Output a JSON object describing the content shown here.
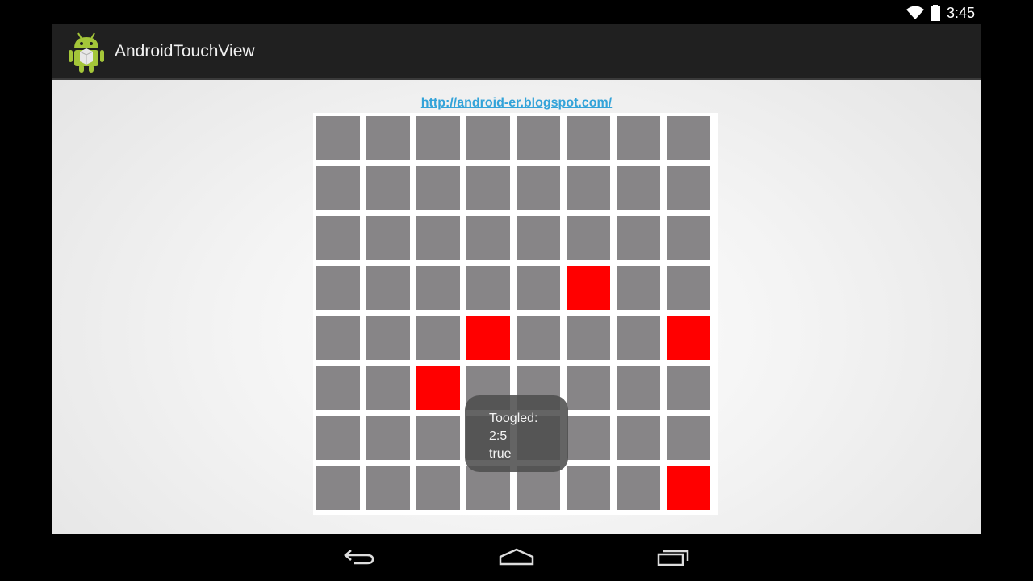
{
  "status_bar": {
    "time": "3:45"
  },
  "action_bar": {
    "title": "AndroidTouchView",
    "icon": "android-robot-icon"
  },
  "link": {
    "text": "http://android-er.blogspot.com/"
  },
  "grid": {
    "rows": 8,
    "cols": 8,
    "toggled_cells": [
      [
        3,
        5
      ],
      [
        4,
        3
      ],
      [
        4,
        7
      ],
      [
        5,
        2
      ],
      [
        7,
        7
      ]
    ],
    "colors": {
      "off": "#878587",
      "on": "#ff0000"
    }
  },
  "toast": {
    "line1": "Toogled:",
    "line2": "2:5",
    "line3": "true"
  },
  "nav": {
    "back": "back-icon",
    "home": "home-icon",
    "recents": "recents-icon"
  }
}
